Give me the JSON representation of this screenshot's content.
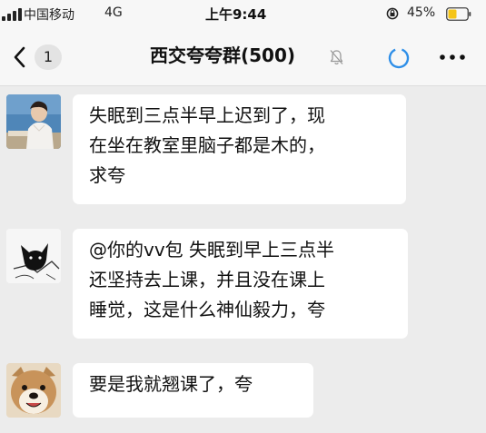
{
  "status_bar": {
    "carrier": "中国移动",
    "network": "4G",
    "time": "上午9:44",
    "battery_percent": "45%",
    "battery_level": 0.45,
    "battery_color": "#f5c518"
  },
  "nav_bar": {
    "back_icon": "chevron-left-icon",
    "unread_count": "1",
    "title": "西交夸夸群(500)",
    "mute_icon": "bell-slash-icon",
    "refresh_icon": "circle-refresh-icon",
    "more_icon": "ellipsis-icon"
  },
  "messages": [
    {
      "avatar": "person-photo-avatar",
      "lines": [
        "失眠到三点半早上迟到了，现",
        "在坐在教室里脑子都是木的，",
        "求夸"
      ]
    },
    {
      "avatar": "cat-sketch-avatar",
      "lines": [
        "@你的vv包 失眠到早上三点半",
        "还坚持去上课，并且没在课上",
        "睡觉，这是什么神仙毅力，夸"
      ]
    },
    {
      "avatar": "dog-avatar",
      "lines": [
        "要是我就翘课了，夸"
      ]
    }
  ],
  "colors": {
    "accent": "#2f8fe8",
    "bubble": "#ffffff",
    "chat_background": "#ececec"
  }
}
